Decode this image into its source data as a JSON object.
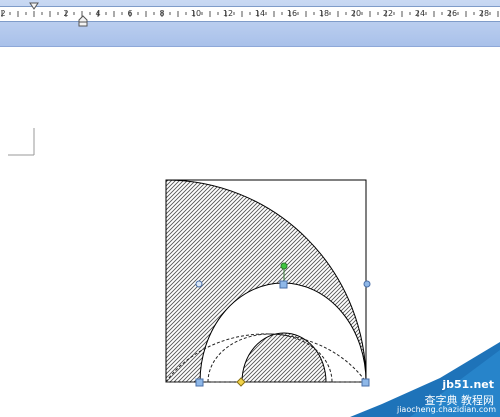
{
  "ruler": {
    "numbers": [
      "2",
      "2",
      "4",
      "6",
      "8",
      "10",
      "12",
      "14",
      "16",
      "18",
      "20",
      "22",
      "24",
      "26",
      "28"
    ]
  },
  "shape": {
    "handles": {
      "selection": "light blue",
      "rotation": "green",
      "adjust": "yellow"
    }
  },
  "watermark": {
    "site": "jb51.net",
    "title": "查字典 教程网",
    "url": "jiaocheng.chazidian.com"
  },
  "colors": {
    "ruler_band": "#b7cbef",
    "hatch": "#555555",
    "handle": "#8fb8e8",
    "rotate_handle": "#3fc43f",
    "adjust_handle": "#f2d34a",
    "watermark_bg": "#1e73b9"
  }
}
